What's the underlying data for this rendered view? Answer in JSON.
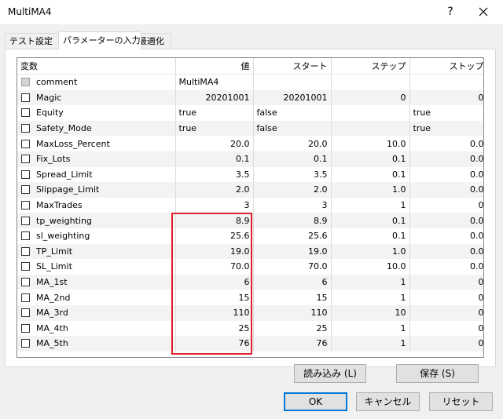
{
  "window": {
    "title": "MultiMA4",
    "help_label": "?"
  },
  "tabs": [
    {
      "label": "テスト設定"
    },
    {
      "label": "パラメーターの入力"
    },
    {
      "label": "最適化"
    }
  ],
  "columns": [
    "変数",
    "値",
    "スタート",
    "ステップ",
    "ストップ"
  ],
  "rows": [
    {
      "name": "comment",
      "value": "MultiMA4",
      "start": "",
      "step": "",
      "stop": "",
      "disabled": true
    },
    {
      "name": "Magic",
      "value": "20201001",
      "start": "20201001",
      "step": "0",
      "stop": "0"
    },
    {
      "name": "Equity",
      "value": "true",
      "start": "false",
      "step": "",
      "stop": "true"
    },
    {
      "name": "Safety_Mode",
      "value": "true",
      "start": "false",
      "step": "",
      "stop": "true"
    },
    {
      "name": "MaxLoss_Percent",
      "value": "20.0",
      "start": "20.0",
      "step": "10.0",
      "stop": "0.0"
    },
    {
      "name": "Fix_Lots",
      "value": "0.1",
      "start": "0.1",
      "step": "0.1",
      "stop": "0.0"
    },
    {
      "name": "Spread_Limit",
      "value": "3.5",
      "start": "3.5",
      "step": "0.1",
      "stop": "0.0"
    },
    {
      "name": "Slippage_Limit",
      "value": "2.0",
      "start": "2.0",
      "step": "1.0",
      "stop": "0.0"
    },
    {
      "name": "MaxTrades",
      "value": "3",
      "start": "3",
      "step": "1",
      "stop": "0"
    },
    {
      "name": "tp_weighting",
      "value": "8.9",
      "start": "8.9",
      "step": "0.1",
      "stop": "0.0"
    },
    {
      "name": "sl_weighting",
      "value": "25.6",
      "start": "25.6",
      "step": "0.1",
      "stop": "0.0"
    },
    {
      "name": "TP_Limit",
      "value": "19.0",
      "start": "19.0",
      "step": "1.0",
      "stop": "0.0"
    },
    {
      "name": "SL_Limit",
      "value": "70.0",
      "start": "70.0",
      "step": "10.0",
      "stop": "0.0"
    },
    {
      "name": "MA_1st",
      "value": "6",
      "start": "6",
      "step": "1",
      "stop": "0"
    },
    {
      "name": "MA_2nd",
      "value": "15",
      "start": "15",
      "step": "1",
      "stop": "0"
    },
    {
      "name": "MA_3rd",
      "value": "110",
      "start": "110",
      "step": "10",
      "stop": "0"
    },
    {
      "name": "MA_4th",
      "value": "25",
      "start": "25",
      "step": "1",
      "stop": "0"
    },
    {
      "name": "MA_5th",
      "value": "76",
      "start": "76",
      "step": "1",
      "stop": "0"
    }
  ],
  "buttons": {
    "load": "読み込み (L)",
    "save": "保存 (S)",
    "ok": "OK",
    "cancel": "キャンセル",
    "reset": "リセット"
  },
  "colors": {
    "highlight": "#e0202c",
    "default_button_border": "#0078d7"
  }
}
